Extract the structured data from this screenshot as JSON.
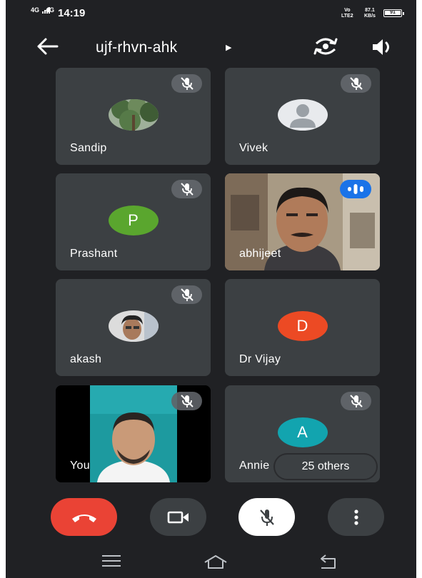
{
  "status_bar": {
    "sig1": "4G",
    "sig2": "4G",
    "time": "14:19",
    "net_top": "Vo",
    "net_bottom": "LTE2",
    "speed_value": "87.1",
    "speed_unit": "KB/s",
    "battery": "91"
  },
  "header": {
    "meeting_code": "ujf-rhvn-ahk",
    "back_icon": "arrow-left-icon",
    "switch_camera_icon": "switch-camera-icon",
    "speaker_icon": "speaker-icon"
  },
  "participants": [
    {
      "name": "Sandip",
      "avatar": "photo",
      "muted": true
    },
    {
      "name": "Vivek",
      "avatar": "default-person",
      "muted": true
    },
    {
      "name": "Prashant",
      "avatar_letter": "P",
      "avatar_color": "#5aa62e",
      "muted": true
    },
    {
      "name": "abhijeet",
      "avatar": "video",
      "speaking": true
    },
    {
      "name": "akash",
      "avatar": "photo",
      "muted": true
    },
    {
      "name": "Dr Vijay",
      "avatar_letter": "D",
      "avatar_color": "#ec4a24",
      "muted": true
    },
    {
      "name": "You",
      "avatar": "video",
      "muted": true
    },
    {
      "name": "Annie",
      "avatar_letter": "A",
      "avatar_color": "#12a4af",
      "muted": true
    }
  ],
  "others_label": "25 others",
  "controls": {
    "end_call_icon": "phone-hangup-icon",
    "camera_icon": "video-camera-icon",
    "mic_icon": "mic-off-icon",
    "more_icon": "more-vertical-icon"
  },
  "nav": {
    "menu_icon": "menu-icon",
    "home_icon": "home-icon",
    "back_icon": "back-icon"
  },
  "colors": {
    "background": "#202124",
    "tile": "#3c4043",
    "end_call": "#ea4335",
    "speaking": "#1a73e8"
  }
}
